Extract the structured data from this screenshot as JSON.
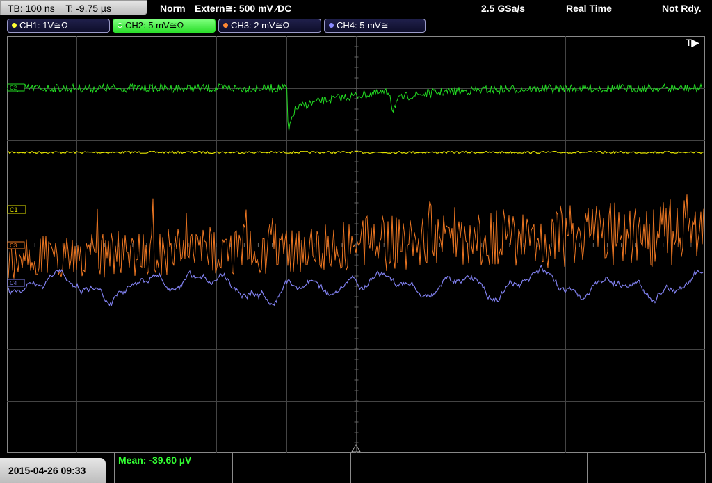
{
  "topbar": {
    "timebase": "TB: 100 ns",
    "trigger_time": "T: -9.75 µs",
    "mode": "Norm",
    "trigger_source": "Extern≅: 500 mV ⁄DC",
    "sample_rate": "2.5 GSa/s",
    "acquisition": "Real Time",
    "status": "Not Rdy."
  },
  "channels": [
    {
      "label": "CH1: 1V≅Ω",
      "color": "#ffff33",
      "marker": "C1"
    },
    {
      "label": "CH2: 5 mV≅Ω",
      "color": "#33ff33",
      "marker": "C2"
    },
    {
      "label": "CH3: 2 mV≅Ω",
      "color": "#ff8833",
      "marker": "C3"
    },
    {
      "label": "CH4: 5 mV≅",
      "color": "#8a8aff",
      "marker": "C4"
    }
  ],
  "trigger_marker": "T▶",
  "date_time": "2015-04-26 09:33",
  "measurement": "Mean: -39.60 µV",
  "colors": {
    "grid": "#444444",
    "ch1": "#e6e600",
    "ch2": "#22dd22",
    "ch3": "#ee7722",
    "ch4": "#8080ee"
  }
}
